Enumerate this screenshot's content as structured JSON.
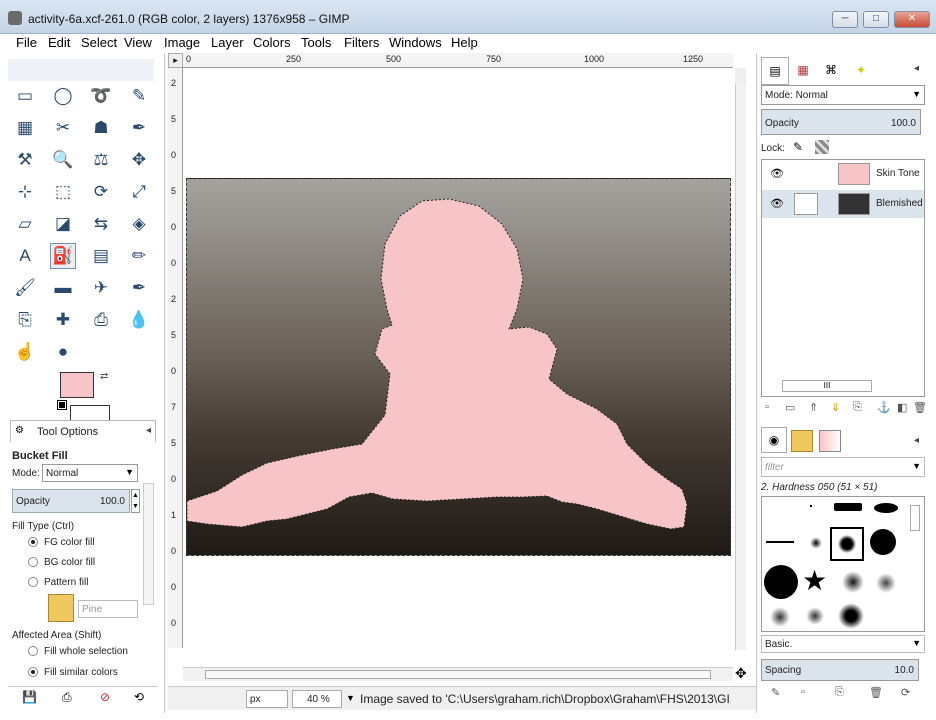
{
  "window": {
    "title": "activity-6a.xcf-261.0 (RGB color, 2 layers) 1376x958 – GIMP",
    "min": "─",
    "max": "□",
    "close": "✕"
  },
  "menu": [
    "File",
    "Edit",
    "Select",
    "View",
    "Image",
    "Layer",
    "Colors",
    "Tools",
    "Filters",
    "Windows",
    "Help"
  ],
  "toolbox": {
    "tool_icons": [
      "rect-select-icon",
      "ellipse-select-icon",
      "free-select-icon",
      "fuzzy-select-icon",
      "select-by-color-icon",
      "scissors-icon",
      "foreground-select-icon",
      "paths-icon",
      "color-picker-icon",
      "zoom-icon",
      "measure-icon",
      "move-icon",
      "align-icon",
      "crop-icon",
      "rotate-icon",
      "scale-icon",
      "shear-icon",
      "perspective-icon",
      "flip-icon",
      "cage-icon",
      "text-icon",
      "bucket-fill-icon",
      "blend-icon",
      "pencil-icon",
      "paintbrush-icon",
      "eraser-icon",
      "airbrush-icon",
      "ink-icon",
      "clone-icon",
      "heal-icon",
      "perspective-clone-icon",
      "blur-icon",
      "smudge-icon",
      "dodge-burn-icon"
    ],
    "tool_glyphs": [
      "▭",
      "◯",
      "➰",
      "✎",
      "▦",
      "✂",
      "☗",
      "✒",
      "⚒",
      "🔍",
      "⚖",
      "✥",
      "⊹",
      "⬚",
      "⟳",
      "⤢",
      "▱",
      "◪",
      "⇆",
      "◈",
      "A",
      "⛽",
      "▤",
      "✏",
      "🖌",
      "▬",
      "✈",
      "✒",
      "⎘",
      "✚",
      "⎙",
      "💧",
      "☝",
      "●"
    ],
    "selected_tool": 21,
    "fg_color": "#f7c4c8",
    "bg_color": "#ffffff"
  },
  "tool_options": {
    "tab": "Tool Options",
    "title": "Bucket Fill",
    "mode_label": "Mode:",
    "mode_value": "Normal",
    "opacity_label": "Opacity",
    "opacity_value": "100.0",
    "fill_type_label": "Fill Type  (Ctrl)",
    "fill_types": [
      "FG color fill",
      "BG color fill",
      "Pattern fill"
    ],
    "fill_type_selected": 0,
    "pattern_name": "Pine",
    "affected_label": "Affected Area  (Shift)",
    "affected": [
      "Fill whole selection",
      "Fill similar colors"
    ],
    "affected_selected": 1
  },
  "canvas": {
    "ruler_top": [
      "0",
      "250",
      "500",
      "750",
      "1000",
      "1250"
    ],
    "ruler_left": [
      "2",
      "5",
      "0",
      "5",
      "0",
      "0",
      "2",
      "5",
      "0",
      "7",
      "5",
      "0",
      "1",
      "0",
      "0",
      "0"
    ]
  },
  "status": {
    "unit": "px",
    "zoom": "40 %",
    "message": "Image saved to 'C:\\Users\\graham.rich\\Dropbox\\Graham\\FHS\\2013\\GI..."
  },
  "layers": {
    "mode_label": "Mode: Normal",
    "opacity_label": "Opacity",
    "opacity_value": "100.0",
    "lock_label": "Lock:",
    "items": [
      {
        "name": "Skin Tone"
      },
      {
        "name": "Blemished"
      }
    ],
    "scrollbar_grip": "III"
  },
  "brushes": {
    "filter_placeholder": "filter",
    "brush_name": "2. Hardness 050 (51 × 51)",
    "category": "Basic.",
    "spacing_label": "Spacing",
    "spacing_value": "10.0"
  },
  "colors": {
    "accent": "#f7c4c8",
    "selection": "#dbe3ec"
  }
}
